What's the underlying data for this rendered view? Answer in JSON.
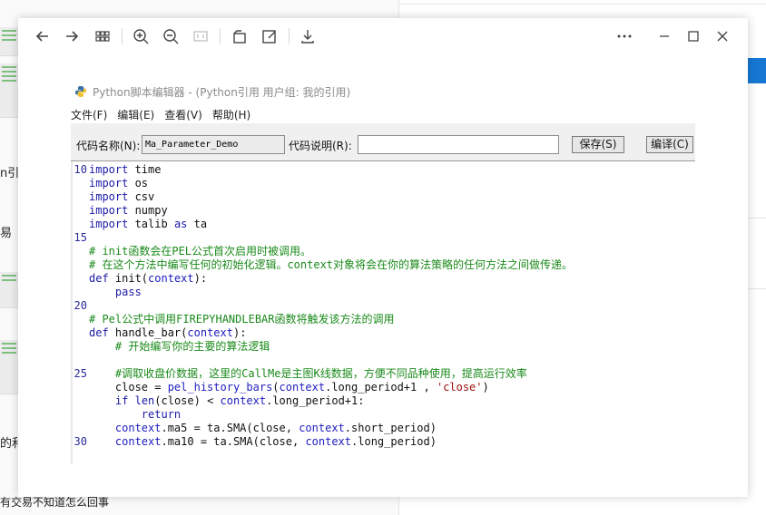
{
  "background": {
    "left_snippets": [
      "n引",
      "易",
      "的和",
      "有交易不知道怎么回事"
    ]
  },
  "toolbar": {
    "back": "back-arrow-icon",
    "forward": "forward-arrow-icon",
    "grid": "grid-icon",
    "zoom_in": "zoom-in-icon",
    "zoom_out": "zoom-out-icon",
    "fit": "fit-page-icon",
    "rotate": "rotate-icon",
    "edit": "edit-icon",
    "download": "download-icon",
    "more": "more-icon",
    "minimize": "minimize-icon",
    "maximize": "maximize-icon",
    "close": "close-icon"
  },
  "editor": {
    "title": "Python脚本编辑器 - (Python引用 用户组: 我的引用)",
    "menu": [
      "文件(F)",
      "编辑(E)",
      "查看(V)",
      "帮助(H)"
    ],
    "form": {
      "code_name_label": "代码名称(N):",
      "code_name_value": "Ma_Parameter_Demo",
      "code_desc_label": "代码说明(R):",
      "code_desc_value": "",
      "save_label": "保存(S)",
      "compile_label": "编译(C)"
    },
    "line_numbers": {
      "l10": "10",
      "l15": "15",
      "l20": "20",
      "l25": "25",
      "l30": "30"
    },
    "code": {
      "c1a": "import",
      "c1b": " time",
      "c2a": "import",
      "c2b": " os",
      "c3a": "import",
      "c3b": " csv",
      "c4a": "import",
      "c4b": " numpy",
      "c5a": "import",
      "c5b": " talib ",
      "c5c": "as",
      "c5d": " ta",
      "c7": "# init函数会在PEL公式首次启用时被调用。",
      "c8": "# 在这个方法中编写任何的初始化逻辑。context对象将会在你的算法策略的任何方法之间做传递。",
      "c9a": "def",
      "c9b": " init(",
      "c9c": "context",
      "c9d": "):",
      "c10": "    pass",
      "c12": "# Pel公式中调用FIREPYHANDLEBAR函数将触发该方法的调用",
      "c13a": "def",
      "c13b": " handle_bar(",
      "c13c": "context",
      "c13d": "):",
      "c14": "    # 开始编写你的主要的算法逻辑",
      "c16": "    #调取收盘价数据，这里的CallMe是主图K线数据，方便不同品种使用，提高运行效率",
      "c17a": "    close = ",
      "c17b": "pel_history_bars",
      "c17c": "(",
      "c17d": "context",
      "c17e": ".long_period+1 , ",
      "c17f": "'close'",
      "c17g": ")",
      "c18a": "    ",
      "c18b": "if",
      "c18c": " ",
      "c18d": "len",
      "c18e": "(close) < ",
      "c18f": "context",
      "c18g": ".long_period+1:",
      "c19": "        return",
      "c20a": "    ",
      "c20b": "context",
      "c20c": ".ma5 = ta.SMA(close, ",
      "c20d": "context",
      "c20e": ".short_period)",
      "c21a": "    ",
      "c21b": "context",
      "c21c": ".ma10 = ta.SMA(close, ",
      "c21d": "context",
      "c21e": ".long_period)"
    }
  }
}
